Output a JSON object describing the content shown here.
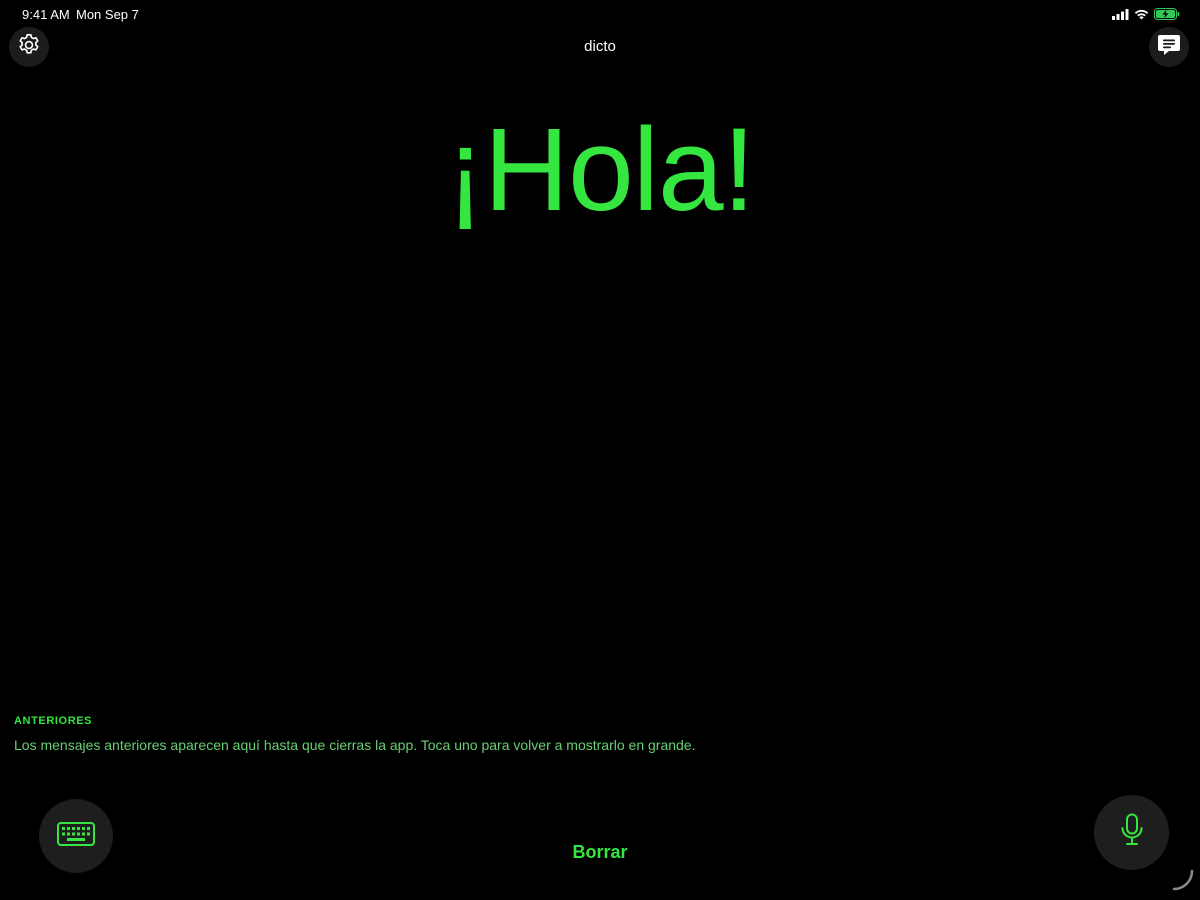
{
  "status_bar": {
    "time": "9:41 AM",
    "date": "Mon Sep 7",
    "icons": [
      "cellular-signal-icon",
      "wifi-icon",
      "battery-charging-icon"
    ]
  },
  "header": {
    "title": "dicto",
    "left_icon": "gear-icon",
    "right_icon": "message-bubble-icon"
  },
  "display": {
    "message": "¡Hola!"
  },
  "history": {
    "heading": "ANTERIORES",
    "hint": "Los mensajes anteriores aparecen aquí hasta que cierras la app. Toca uno para volver a mostrarlo en grande."
  },
  "controls": {
    "clear_label": "Borrar",
    "left_icon": "keyboard-icon",
    "right_icon": "microphone-icon"
  },
  "colors": {
    "accent": "#34e63f",
    "background": "#000000",
    "button_bg": "#1e1e1e"
  }
}
